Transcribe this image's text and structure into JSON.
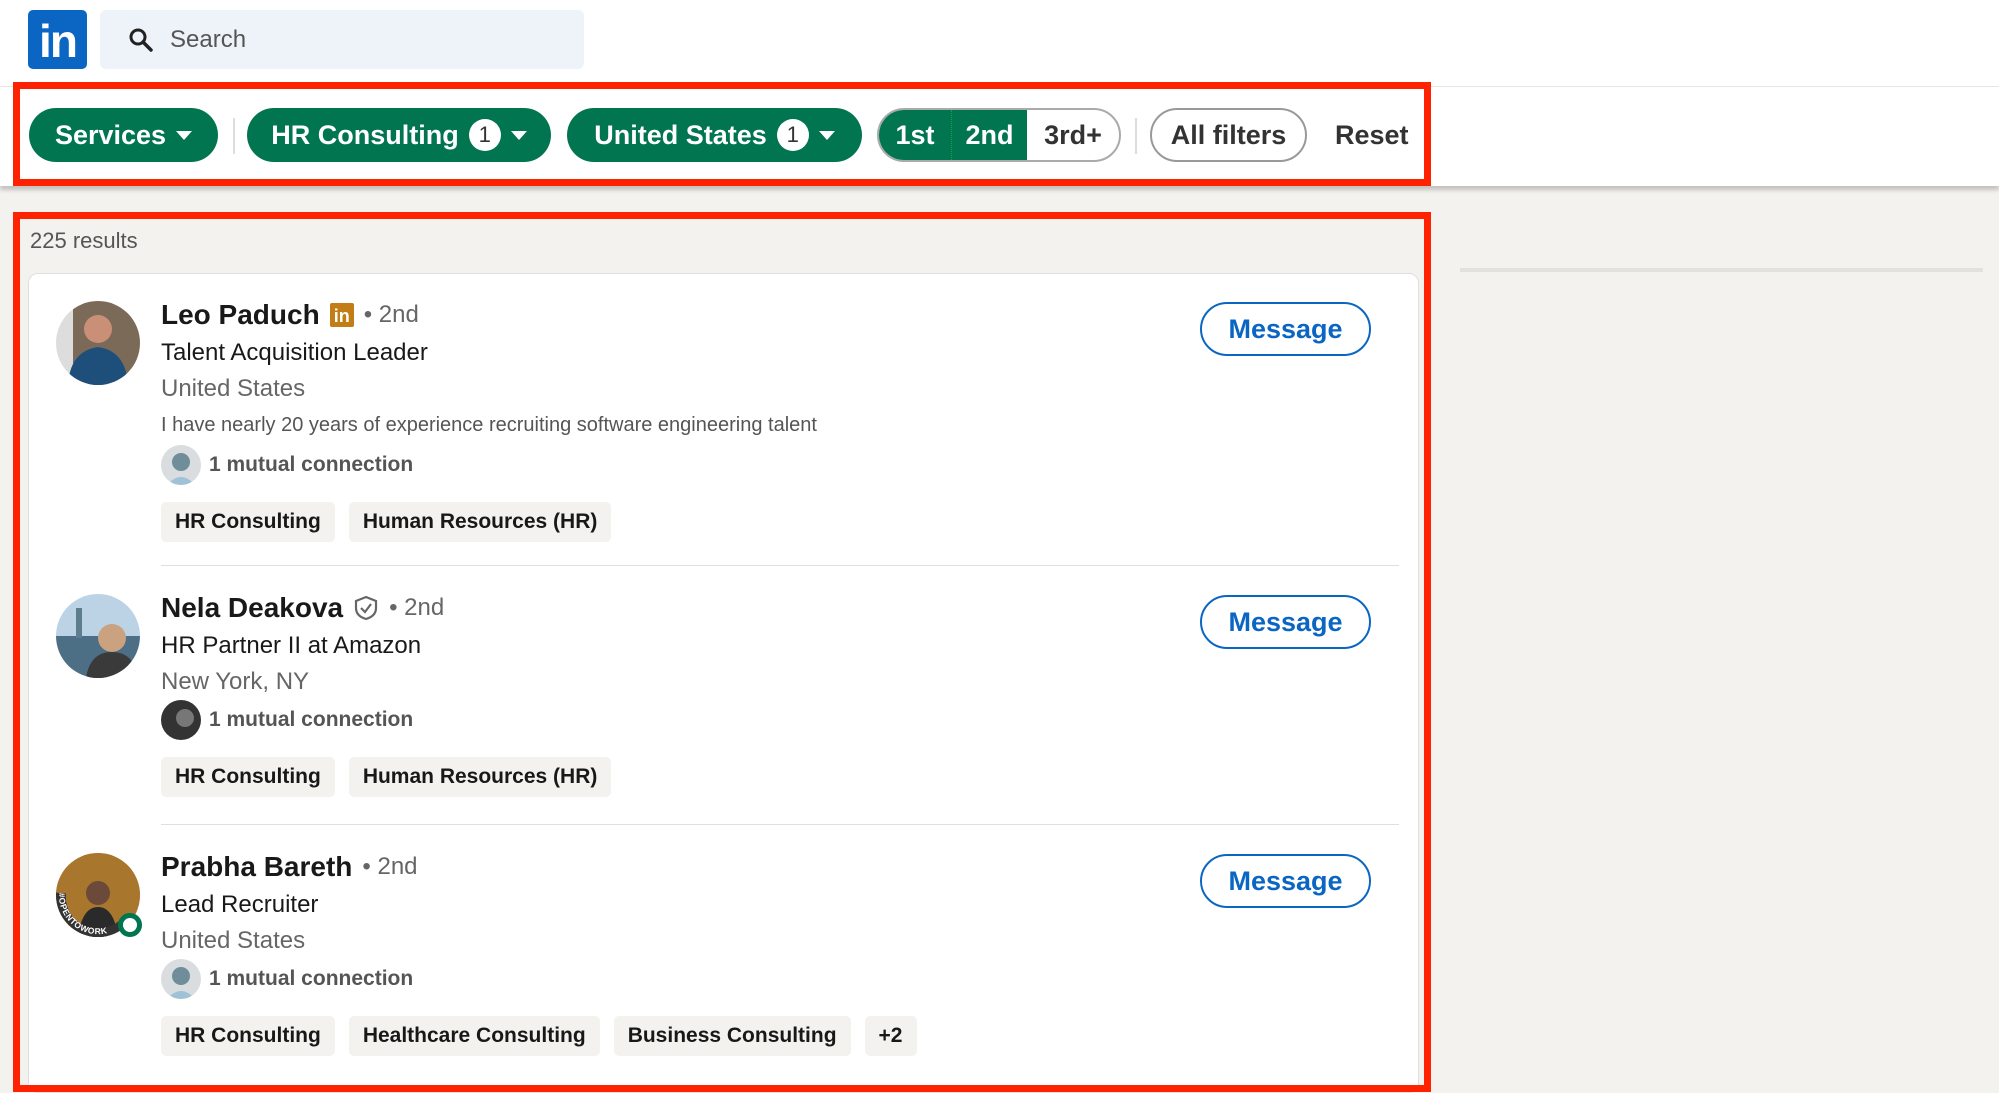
{
  "header": {
    "logo_text": "in",
    "search_placeholder": "Search"
  },
  "filters": {
    "services": "Services",
    "hr_consulting": {
      "label": "HR Consulting",
      "count": "1"
    },
    "location": {
      "label": "United States",
      "count": "1"
    },
    "degrees": [
      {
        "label": "1st",
        "selected": true
      },
      {
        "label": "2nd",
        "selected": true
      },
      {
        "label": "3rd+",
        "selected": false
      }
    ],
    "all_filters": "All filters",
    "reset": "Reset"
  },
  "results_count": "225 results",
  "people": [
    {
      "name": "Leo Paduch",
      "badge": "in",
      "degree": "• 2nd",
      "title": "Talent Acquisition Leader",
      "location": "United States",
      "description": "I have nearly 20 years of experience recruiting software engineering talent",
      "mutual": "1 mutual connection",
      "tags": [
        "HR Consulting",
        "Human Resources (HR)"
      ],
      "action": "Message"
    },
    {
      "name": "Nela Deakova",
      "badge": "verified",
      "degree": "• 2nd",
      "title": "HR Partner II at Amazon",
      "location": "New York, NY",
      "mutual": "1 mutual connection",
      "tags": [
        "HR Consulting",
        "Human Resources (HR)"
      ],
      "action": "Message"
    },
    {
      "name": "Prabha Bareth",
      "degree": "• 2nd",
      "title": "Lead Recruiter",
      "location": "United States",
      "mutual": "1 mutual connection",
      "tags": [
        "HR Consulting",
        "Healthcare Consulting",
        "Business Consulting",
        "+2"
      ],
      "action": "Message",
      "open_to_work": "#OPENTOWORK"
    }
  ],
  "colors": {
    "brand_blue": "#0a66c2",
    "filter_green": "#01754f",
    "highlight_red": "#ff2200"
  }
}
